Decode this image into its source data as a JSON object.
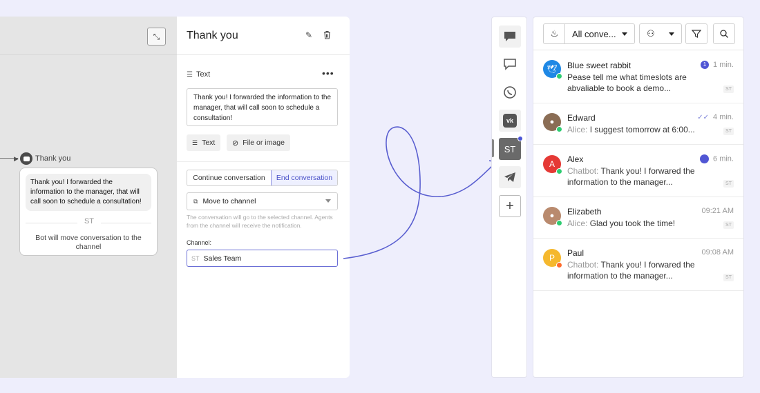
{
  "flow_node": {
    "title": "Thank you",
    "message": "Thank you! I forwarded the information to the manager, that will call soon to schedule a consultation!",
    "channel_badge": "ST",
    "footer": "Bot will move conversation to the channel"
  },
  "editor": {
    "title": "Thank you",
    "block_type": "Text",
    "message": "Thank you! I forwarded the information to the manager, that will call soon to schedule a consultation!",
    "add_text": "Text",
    "add_file": "File or image",
    "tab_continue": "Continue conversation",
    "tab_end": "End conversation",
    "action_select": "Move to channel",
    "hint": "The conversation will go to the selected channel. Agents from the channel will receive the notification.",
    "channel_label": "Channel:",
    "channel_prefix": "ST",
    "channel_value": "Sales Team"
  },
  "channels": {
    "items": [
      "chat",
      "chat-outline",
      "whatsapp",
      "vk",
      "ST",
      "telegram"
    ],
    "active_label": "ST",
    "add": "+"
  },
  "inbox": {
    "filter_label": "All conve...",
    "conversations": [
      {
        "name": "Blue sweet rabbit",
        "time": "1 min.",
        "unread": "1",
        "who": "",
        "message": "Pease tell me what timeslots are abvaliable to book a demo...",
        "badge": "ST",
        "avatar": "",
        "avatar_color": "#1e88e5",
        "presence": "#2ecc71"
      },
      {
        "name": "Edward",
        "time": "4 min.",
        "unread": "",
        "who": "Alice: ",
        "message": "I suggest tomorrow at 6:00...",
        "badge": "ST",
        "avatar": "",
        "avatar_color": "#8a6d55",
        "presence": "#2ecc71"
      },
      {
        "name": "Alex",
        "time": "6 min.",
        "unread": "",
        "who": "Chatbot: ",
        "message": "Thank you! I forwared the information to the manager...",
        "badge": "ST",
        "avatar": "A",
        "avatar_color": "#e53935",
        "presence": "#2ecc71"
      },
      {
        "name": "Elizabeth",
        "time": "09:21 AM",
        "unread": "",
        "who": "Alice: ",
        "message": "Glad you took the time!",
        "badge": "ST",
        "avatar": "",
        "avatar_color": "#b98a6e",
        "presence": "#2ecc71"
      },
      {
        "name": "Paul",
        "time": "09:08 AM",
        "unread": "",
        "who": "Chatbot: ",
        "message": "Thank you! I forwared the information to the manager...",
        "badge": "ST",
        "avatar": "P",
        "avatar_color": "#f5b82e",
        "presence": "#ff6b2c"
      }
    ]
  },
  "colors": {
    "accent": "#4b55d6",
    "canvas": "#e5e5e5",
    "background": "#eeeefc"
  }
}
